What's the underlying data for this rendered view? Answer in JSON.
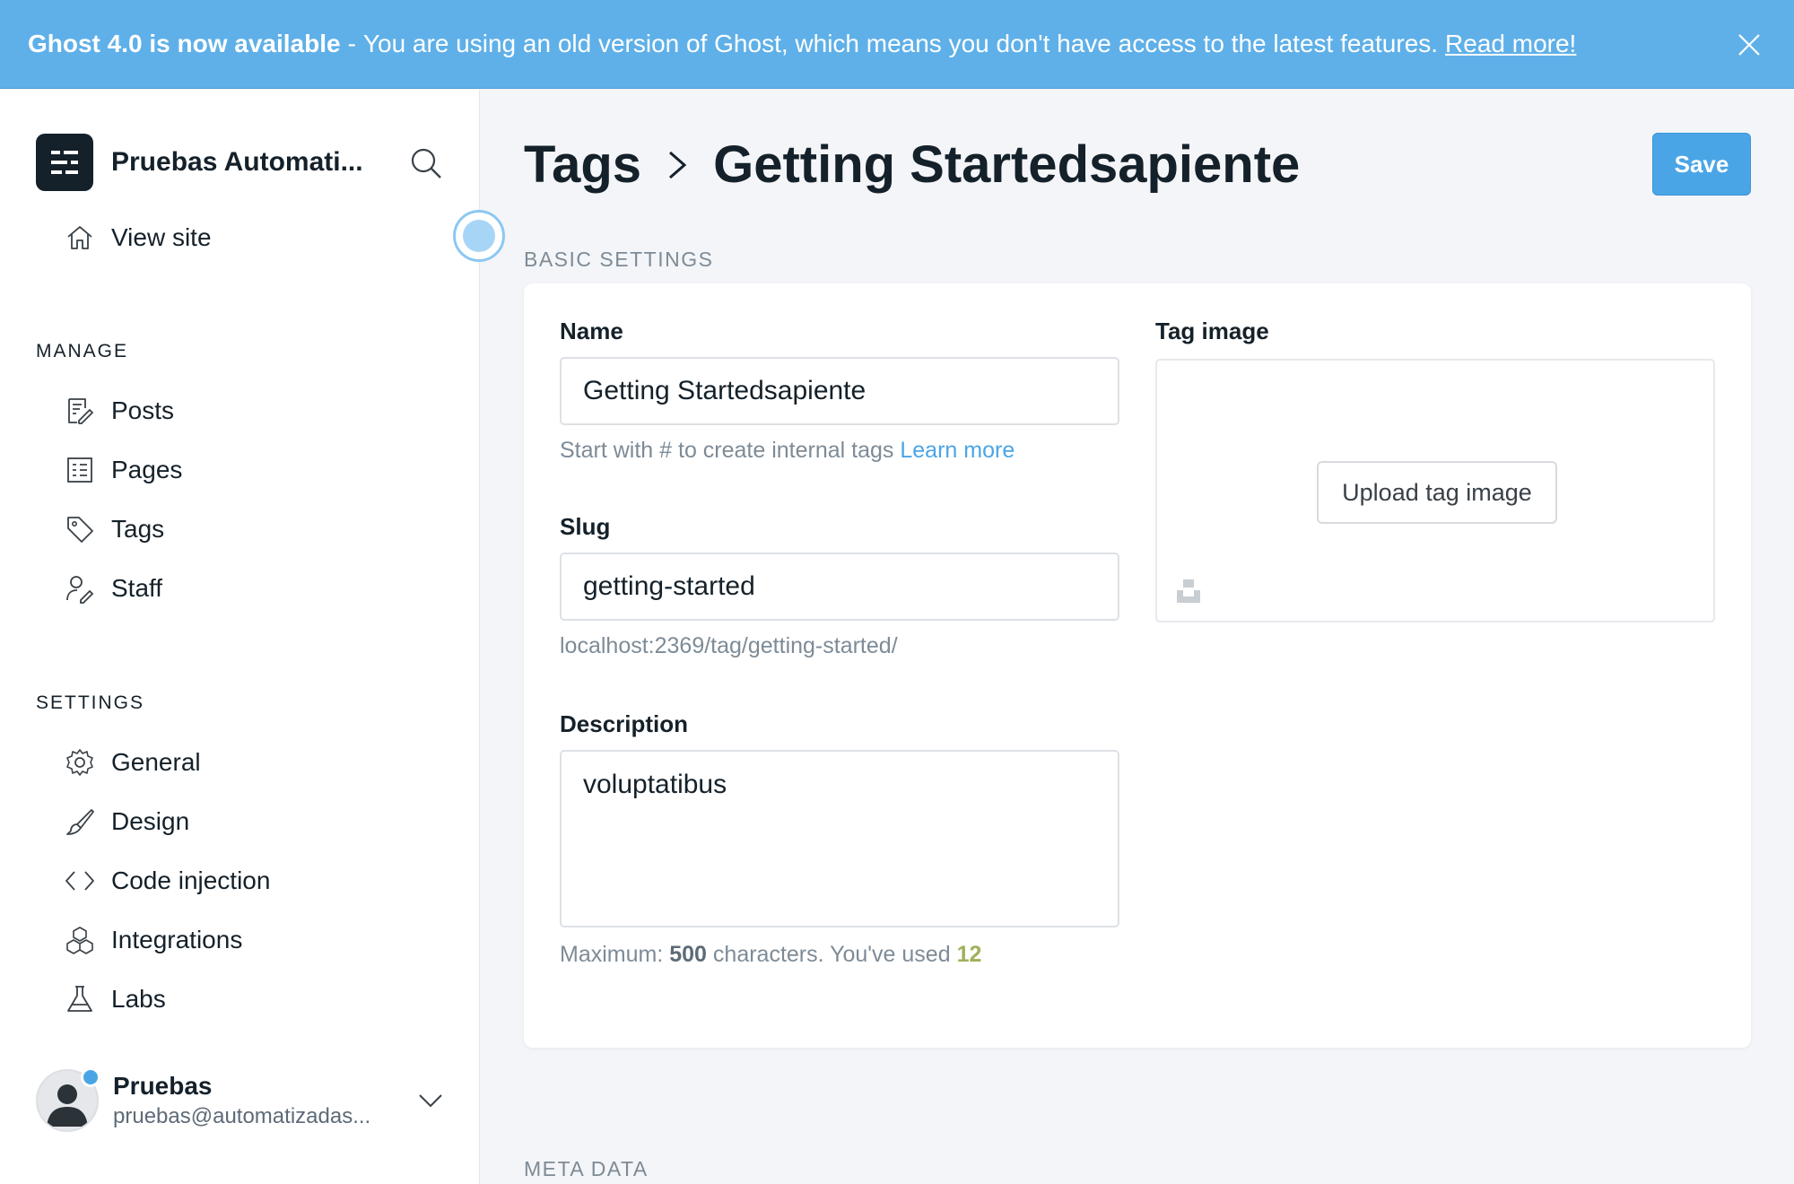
{
  "banner": {
    "title": "Ghost 4.0 is now available",
    "separator": "-",
    "message": "You are using an old version of Ghost, which means you don't have access to the latest features.",
    "link": "Read more!",
    "close_icon": "close-icon"
  },
  "sidebar": {
    "brand": "Pruebas Automati...",
    "view_site": "View site",
    "manage_heading": "MANAGE",
    "manage_items": [
      {
        "label": "Posts",
        "icon": "posts-icon"
      },
      {
        "label": "Pages",
        "icon": "pages-icon"
      },
      {
        "label": "Tags",
        "icon": "tag-icon"
      },
      {
        "label": "Staff",
        "icon": "staff-icon"
      }
    ],
    "settings_heading": "SETTINGS",
    "settings_items": [
      {
        "label": "General",
        "icon": "gear-icon"
      },
      {
        "label": "Design",
        "icon": "brush-icon"
      },
      {
        "label": "Code injection",
        "icon": "code-icon"
      },
      {
        "label": "Integrations",
        "icon": "integrations-icon"
      },
      {
        "label": "Labs",
        "icon": "flask-icon"
      }
    ],
    "user": {
      "name": "Pruebas",
      "email": "pruebas@automatizadas..."
    }
  },
  "header": {
    "breadcrumb_parent": "Tags",
    "breadcrumb_current": "Getting Startedsapiente",
    "save_label": "Save"
  },
  "basic_settings": {
    "heading": "BASIC SETTINGS",
    "name_label": "Name",
    "name_value": "Getting Startedsapiente",
    "name_hint": "Start with # to create internal tags",
    "name_hint_link": "Learn more",
    "slug_label": "Slug",
    "slug_value": "getting-started",
    "slug_url": "localhost:2369/tag/getting-started/",
    "description_label": "Description",
    "description_value": "voluptatibus",
    "desc_hint_prefix": "Maximum:",
    "desc_max": "500",
    "desc_hint_middle": "characters. You've used",
    "desc_used": "12",
    "tag_image_label": "Tag image",
    "upload_label": "Upload tag image"
  },
  "meta_data": {
    "heading": "META DATA"
  },
  "colors": {
    "accent": "#4aa5e6",
    "banner": "#5fb0e8",
    "used_count": "#9fb05a"
  }
}
